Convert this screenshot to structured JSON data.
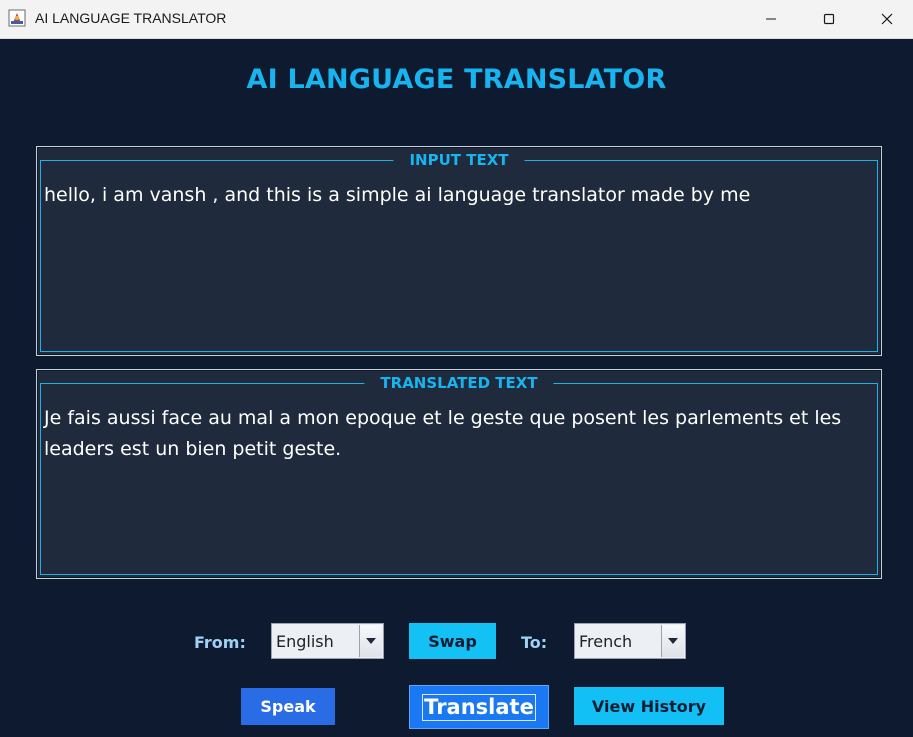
{
  "window": {
    "title": "AI LANGUAGE TRANSLATOR"
  },
  "header": {
    "title": "AI LANGUAGE TRANSLATOR"
  },
  "input_panel": {
    "legend": "INPUT TEXT",
    "text": "hello, i am vansh , and this is a simple ai language translator made by me"
  },
  "output_panel": {
    "legend": "TRANSLATED TEXT",
    "text": "Je fais aussi face au mal a mon epoque et le geste que posent les parlements et les leaders est un bien petit geste."
  },
  "controls": {
    "from_label": "From:",
    "from_value": "English",
    "swap_label": "Swap",
    "to_label": "To:",
    "to_value": "French"
  },
  "actions": {
    "speak_label": "Speak",
    "translate_label": "Translate",
    "history_label": "View History"
  },
  "colors": {
    "background": "#0d1a30",
    "panel": "#1f2a3d",
    "accent": "#18b4f0",
    "translate_button": "#1a78f2",
    "speak_button": "#2a6ce6"
  },
  "icons": {
    "app": "java-app-icon",
    "minimize": "minimize-icon",
    "maximize": "maximize-icon",
    "close": "close-icon",
    "dropdown": "chevron-down-icon"
  }
}
